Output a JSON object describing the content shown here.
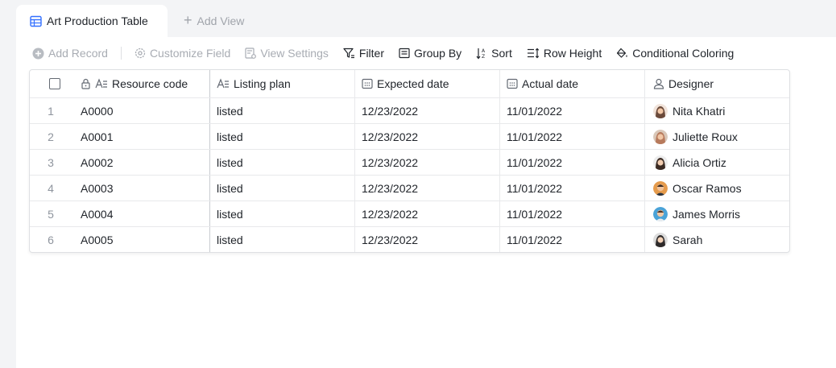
{
  "tabs": {
    "active_label": "Art Production Table",
    "add_view_label": "Add View"
  },
  "toolbar": {
    "add_record": "Add Record",
    "customize_field": "Customize Field",
    "view_settings": "View Settings",
    "filter": "Filter",
    "group_by": "Group By",
    "sort": "Sort",
    "row_height": "Row Height",
    "conditional_coloring": "Conditional Coloring"
  },
  "table": {
    "headers": {
      "resource_code": "Resource code",
      "listing_plan": "Listing plan",
      "expected_date": "Expected date",
      "actual_date": "Actual date",
      "designer": "Designer"
    },
    "rows": [
      {
        "index": "1",
        "code": "A0000",
        "plan": "listed",
        "expected": "12/23/2022",
        "actual": "11/01/2022",
        "designer": "Nita Khatri",
        "avatar_color": "#6b4a3a"
      },
      {
        "index": "2",
        "code": "A0001",
        "plan": "listed",
        "expected": "12/23/2022",
        "actual": "11/01/2022",
        "designer": "Juliette Roux",
        "avatar_color": "#b77a5c"
      },
      {
        "index": "3",
        "code": "A0002",
        "plan": "listed",
        "expected": "12/23/2022",
        "actual": "11/01/2022",
        "designer": "Alicia Ortiz",
        "avatar_color": "#3a2a22"
      },
      {
        "index": "4",
        "code": "A0003",
        "plan": "listed",
        "expected": "12/23/2022",
        "actual": "11/01/2022",
        "designer": "Oscar Ramos",
        "avatar_color": "#e59b4c"
      },
      {
        "index": "5",
        "code": "A0004",
        "plan": "listed",
        "expected": "12/23/2022",
        "actual": "11/01/2022",
        "designer": "James Morris",
        "avatar_color": "#4aa3d8"
      },
      {
        "index": "6",
        "code": "A0005",
        "plan": "listed",
        "expected": "12/23/2022",
        "actual": "11/01/2022",
        "designer": "Sarah",
        "avatar_color": "#2e2a2a"
      }
    ]
  },
  "colors": {
    "accent": "#3370ff",
    "disabled_text": "#a8acb3",
    "border": "#dee0e3"
  }
}
